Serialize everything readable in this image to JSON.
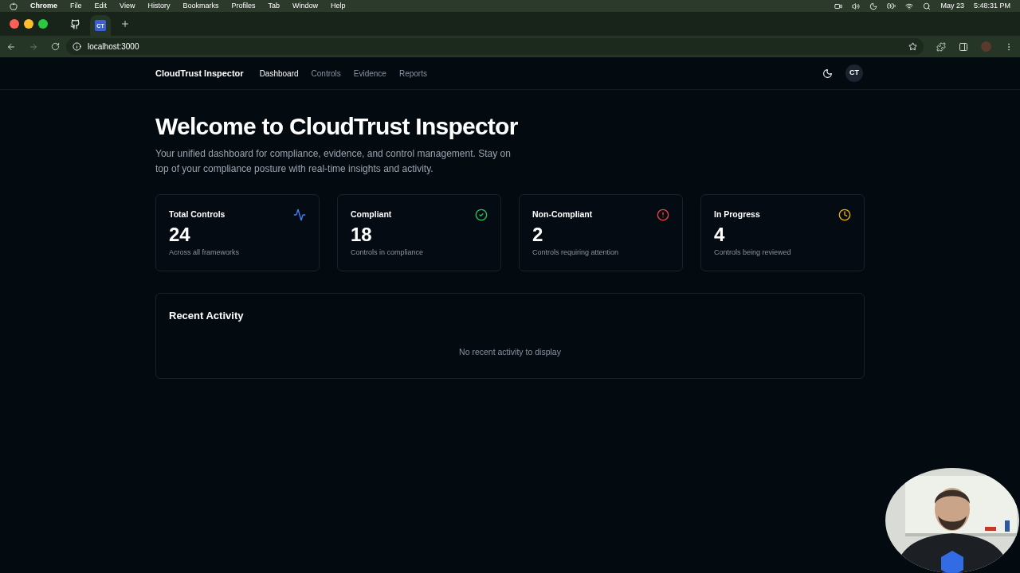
{
  "menu_bar": {
    "app": "Chrome",
    "menus": [
      "File",
      "Edit",
      "View",
      "History",
      "Bookmarks",
      "Profiles",
      "Tab",
      "Window",
      "Help"
    ],
    "date": "May 23",
    "time": "5:48:31 PM"
  },
  "browser": {
    "tab_badge": "CT",
    "url": "localhost:3000"
  },
  "nav": {
    "brand": "CloudTrust Inspector",
    "links": [
      {
        "label": "Dashboard",
        "selected": true
      },
      {
        "label": "Controls",
        "selected": false
      },
      {
        "label": "Evidence",
        "selected": false
      },
      {
        "label": "Reports",
        "selected": false
      }
    ],
    "avatar": "CT"
  },
  "hero": {
    "title": "Welcome to CloudTrust Inspector",
    "subtitle": "Your unified dashboard for compliance, evidence, and control management. Stay on top of your compliance posture with real-time insights and activity."
  },
  "stats": [
    {
      "title": "Total Controls",
      "value": "24",
      "caption": "Across all frameworks",
      "kind": "activity",
      "color": "#3b82f6"
    },
    {
      "title": "Compliant",
      "value": "18",
      "caption": "Controls in compliance",
      "kind": "check",
      "color": "#22c55e"
    },
    {
      "title": "Non-Compliant",
      "value": "2",
      "caption": "Controls requiring attention",
      "kind": "alert",
      "color": "#ef4444"
    },
    {
      "title": "In Progress",
      "value": "4",
      "caption": "Controls being reviewed",
      "kind": "clock",
      "color": "#eab308"
    }
  ],
  "recent_activity": {
    "title": "Recent Activity",
    "empty_message": "No recent activity to display"
  }
}
